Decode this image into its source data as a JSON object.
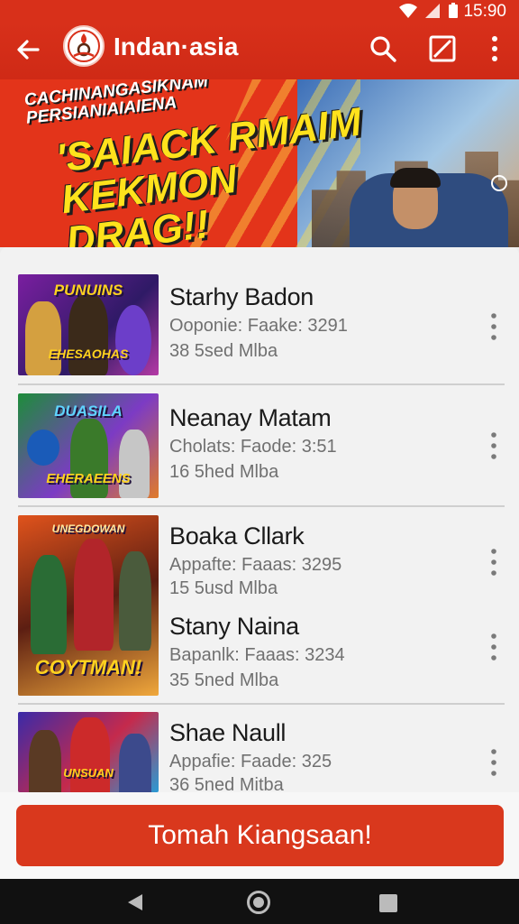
{
  "status_bar": {
    "time": "15:90"
  },
  "app_bar": {
    "title": "Indan·asia"
  },
  "banner": {
    "heading": "CACHINANGASIKNAM PERSIANIAIAIENA",
    "headline": "'SAIACK RMAIM KEKMON DRAG!!"
  },
  "items": [
    {
      "name": "Starhy Badon",
      "line1": "Ooponie: Faake: 3291",
      "line2": "38 5sed Mlba",
      "thumb_top": "PUNUINS",
      "thumb_bottom": "EHESAOHAS"
    },
    {
      "name": "Neanay Matam",
      "line1": "Cholats: Faode: 3:51",
      "line2": "16 5hed Mlba",
      "thumb_top": "DUASILA",
      "thumb_bottom": "EHERAEENS"
    },
    {
      "name": "Boaka Cllark",
      "line1": "Appafte: Faaas: 3295",
      "line2": "15 5usd Mlba",
      "thumb_top": "UNEGDOWAN",
      "thumb_bottom": "COYTMAN!"
    },
    {
      "name": "Stany Naina",
      "line1": "Bapanlk: Faaas: 3234",
      "line2": "35 5ned Mlba"
    },
    {
      "name": "Shae Naull",
      "line1": "Appafie: Faade: 325",
      "line2": "36 5ned Mitba",
      "thumb_top": "",
      "thumb_bottom": "UNSUAN"
    }
  ],
  "cta": {
    "label": "Tomah Kiangsaan!"
  },
  "colors": {
    "primary": "#d8301a",
    "cta": "#d9381d",
    "banner_yellow": "#ffe21c"
  }
}
